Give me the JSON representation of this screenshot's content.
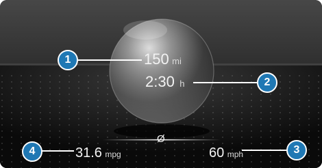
{
  "trip": {
    "range_value": "150",
    "range_unit": "mi",
    "time_value": "2:30",
    "time_unit": "h",
    "average_symbol": "Ø",
    "consumption_value": "31.6",
    "consumption_unit": "mpg",
    "speed_value": "60",
    "speed_unit": "mph"
  },
  "callouts": [
    "1",
    "2",
    "3",
    "4"
  ],
  "colors": {
    "callout_fill": "#1f78b4",
    "callout_border": "#ffffff",
    "text": "#f2f2f2"
  }
}
